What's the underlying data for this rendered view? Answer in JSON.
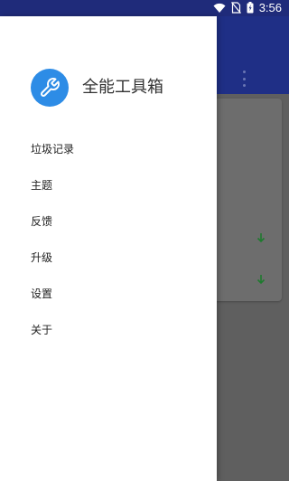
{
  "status_bar": {
    "time": "3:56",
    "icons": [
      "wifi-icon",
      "no-sim-icon",
      "battery-charging-icon"
    ]
  },
  "drawer": {
    "app_name": "全能工具箱",
    "logo_icon": "wrench-icon",
    "items": [
      {
        "label": "垃圾记录"
      },
      {
        "label": "主题"
      },
      {
        "label": "反馈"
      },
      {
        "label": "升级"
      },
      {
        "label": "设置"
      },
      {
        "label": "关于"
      }
    ]
  },
  "background": {
    "toolbar_icon": "overflow-menu-icon",
    "row_icons": [
      "download-arrow-icon",
      "download-arrow-icon"
    ]
  },
  "colors": {
    "status_bar": "#1f2b7a",
    "toolbar": "#1f2f86",
    "logo_bg": "#2d8ce6",
    "scrim": "#5f5f5f",
    "arrow_green": "#1e7a2e"
  }
}
